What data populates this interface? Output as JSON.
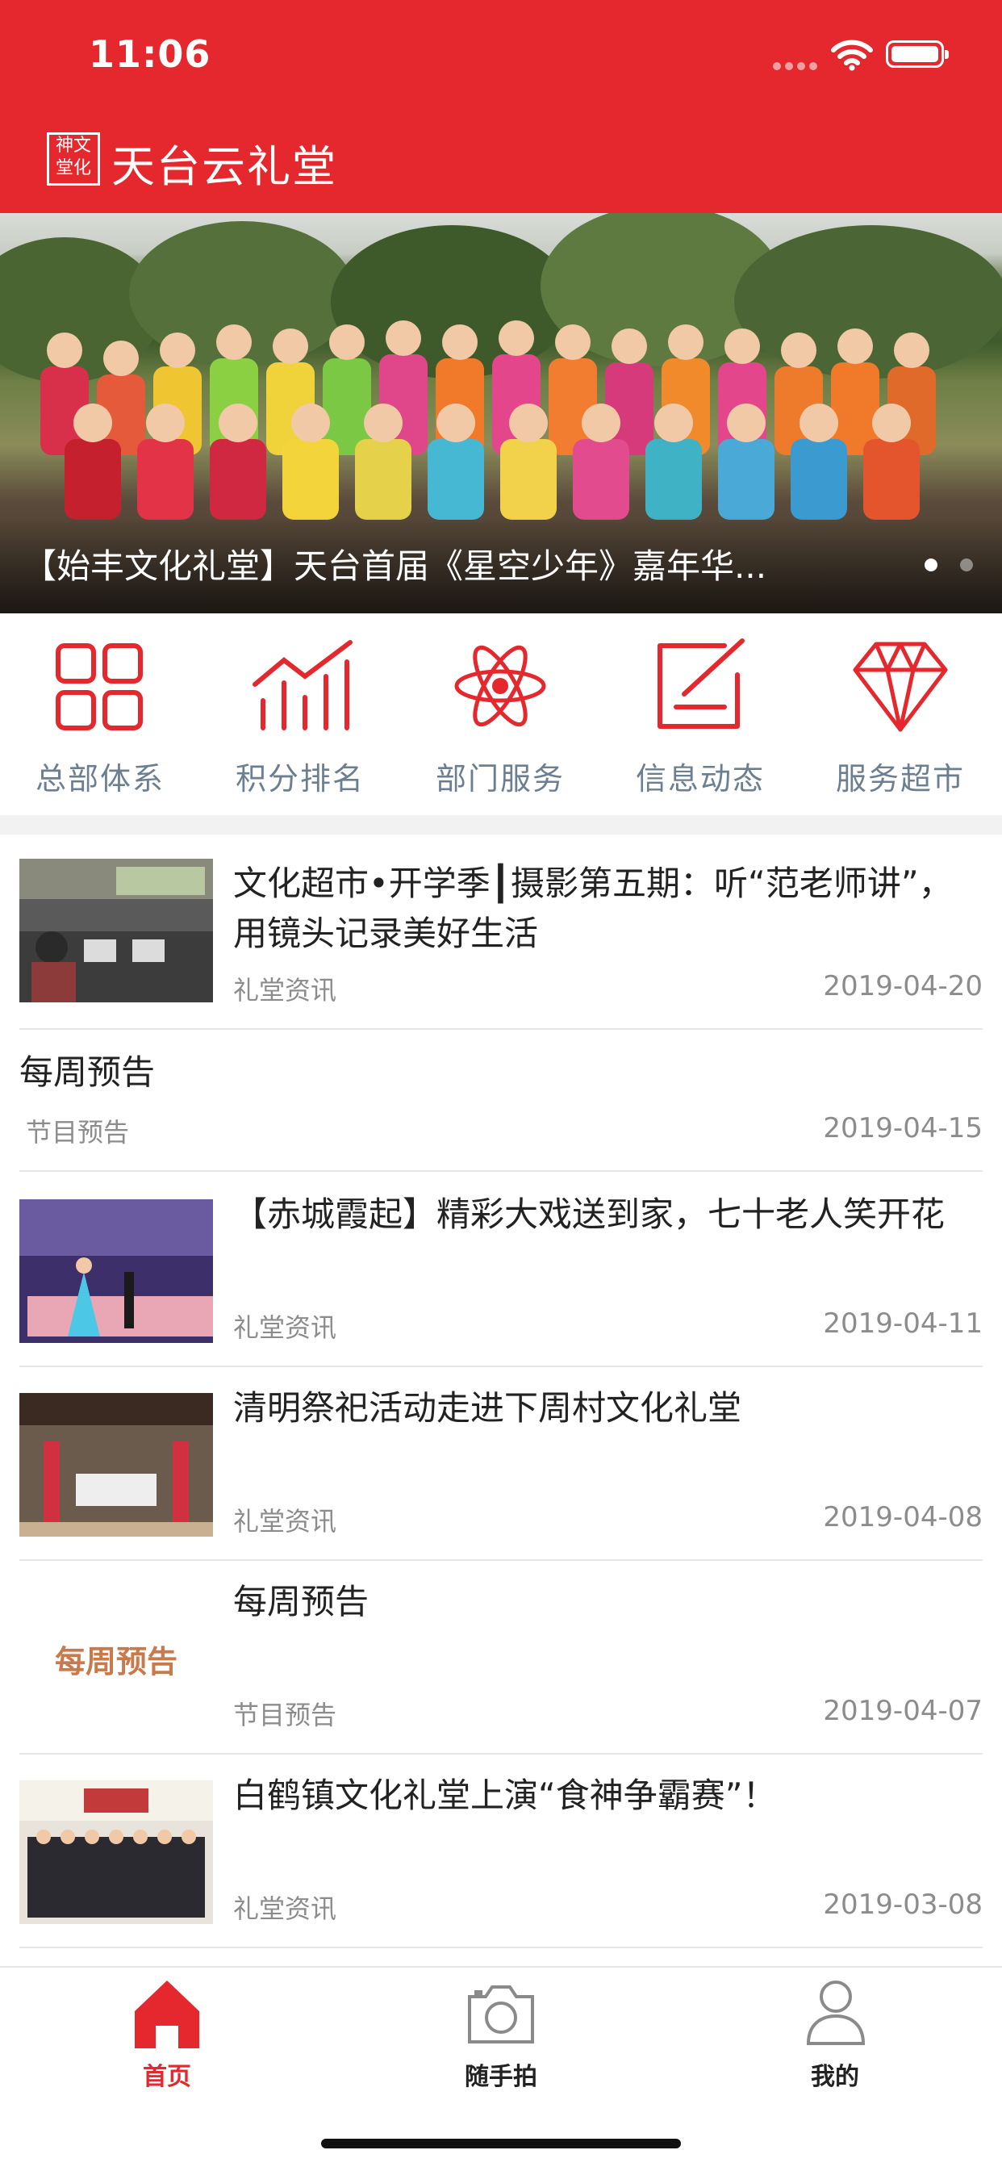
{
  "status_bar": {
    "time": "11:06"
  },
  "app": {
    "logo_text": "神文堂化",
    "title": "天台云礼堂"
  },
  "banner": {
    "caption": "【始丰文化礼堂】天台首届《星空少年》嘉年华...",
    "active_index": 0,
    "dot_count": 2
  },
  "quick_menu": [
    {
      "label": "总部体系",
      "icon": "grid-icon"
    },
    {
      "label": "积分排名",
      "icon": "bar-chart-icon"
    },
    {
      "label": "部门服务",
      "icon": "atom-icon"
    },
    {
      "label": "信息动态",
      "icon": "edit-note-icon"
    },
    {
      "label": "服务超市",
      "icon": "diamond-icon"
    }
  ],
  "news": [
    {
      "title": "文化超市•开学季┃摄影第五期：听“范老师讲”，用镜头记录美好生活",
      "category": "礼堂资讯",
      "date": "2019-04-20",
      "has_thumb": true
    },
    {
      "title": "每周预告",
      "category": "节目预告",
      "date": "2019-04-15",
      "has_thumb": false
    },
    {
      "title": "【赤城霞起】精彩大戏送到家，七十老人笑开花",
      "category": "礼堂资讯",
      "date": "2019-04-11",
      "has_thumb": true
    },
    {
      "title": "清明祭祀活动走进下周村文化礼堂",
      "category": "礼堂资讯",
      "date": "2019-04-08",
      "has_thumb": true
    },
    {
      "title": "每周预告",
      "category": "节目预告",
      "date": "2019-04-07",
      "has_thumb": true,
      "thumb_text": "每周预告"
    },
    {
      "title": "白鹤镇文化礼堂上演“食神争霸赛”！",
      "category": "礼堂资讯",
      "date": "2019-03-08",
      "has_thumb": true
    }
  ],
  "tabbar": [
    {
      "label": "首页",
      "icon": "home-icon",
      "active": true
    },
    {
      "label": "随手拍",
      "icon": "camera-icon",
      "active": false
    },
    {
      "label": "我的",
      "icon": "user-icon",
      "active": false
    }
  ],
  "colors": {
    "brand": "#e4282d",
    "menu_text": "#6c7f91",
    "meta_text": "#8c8c8c"
  }
}
